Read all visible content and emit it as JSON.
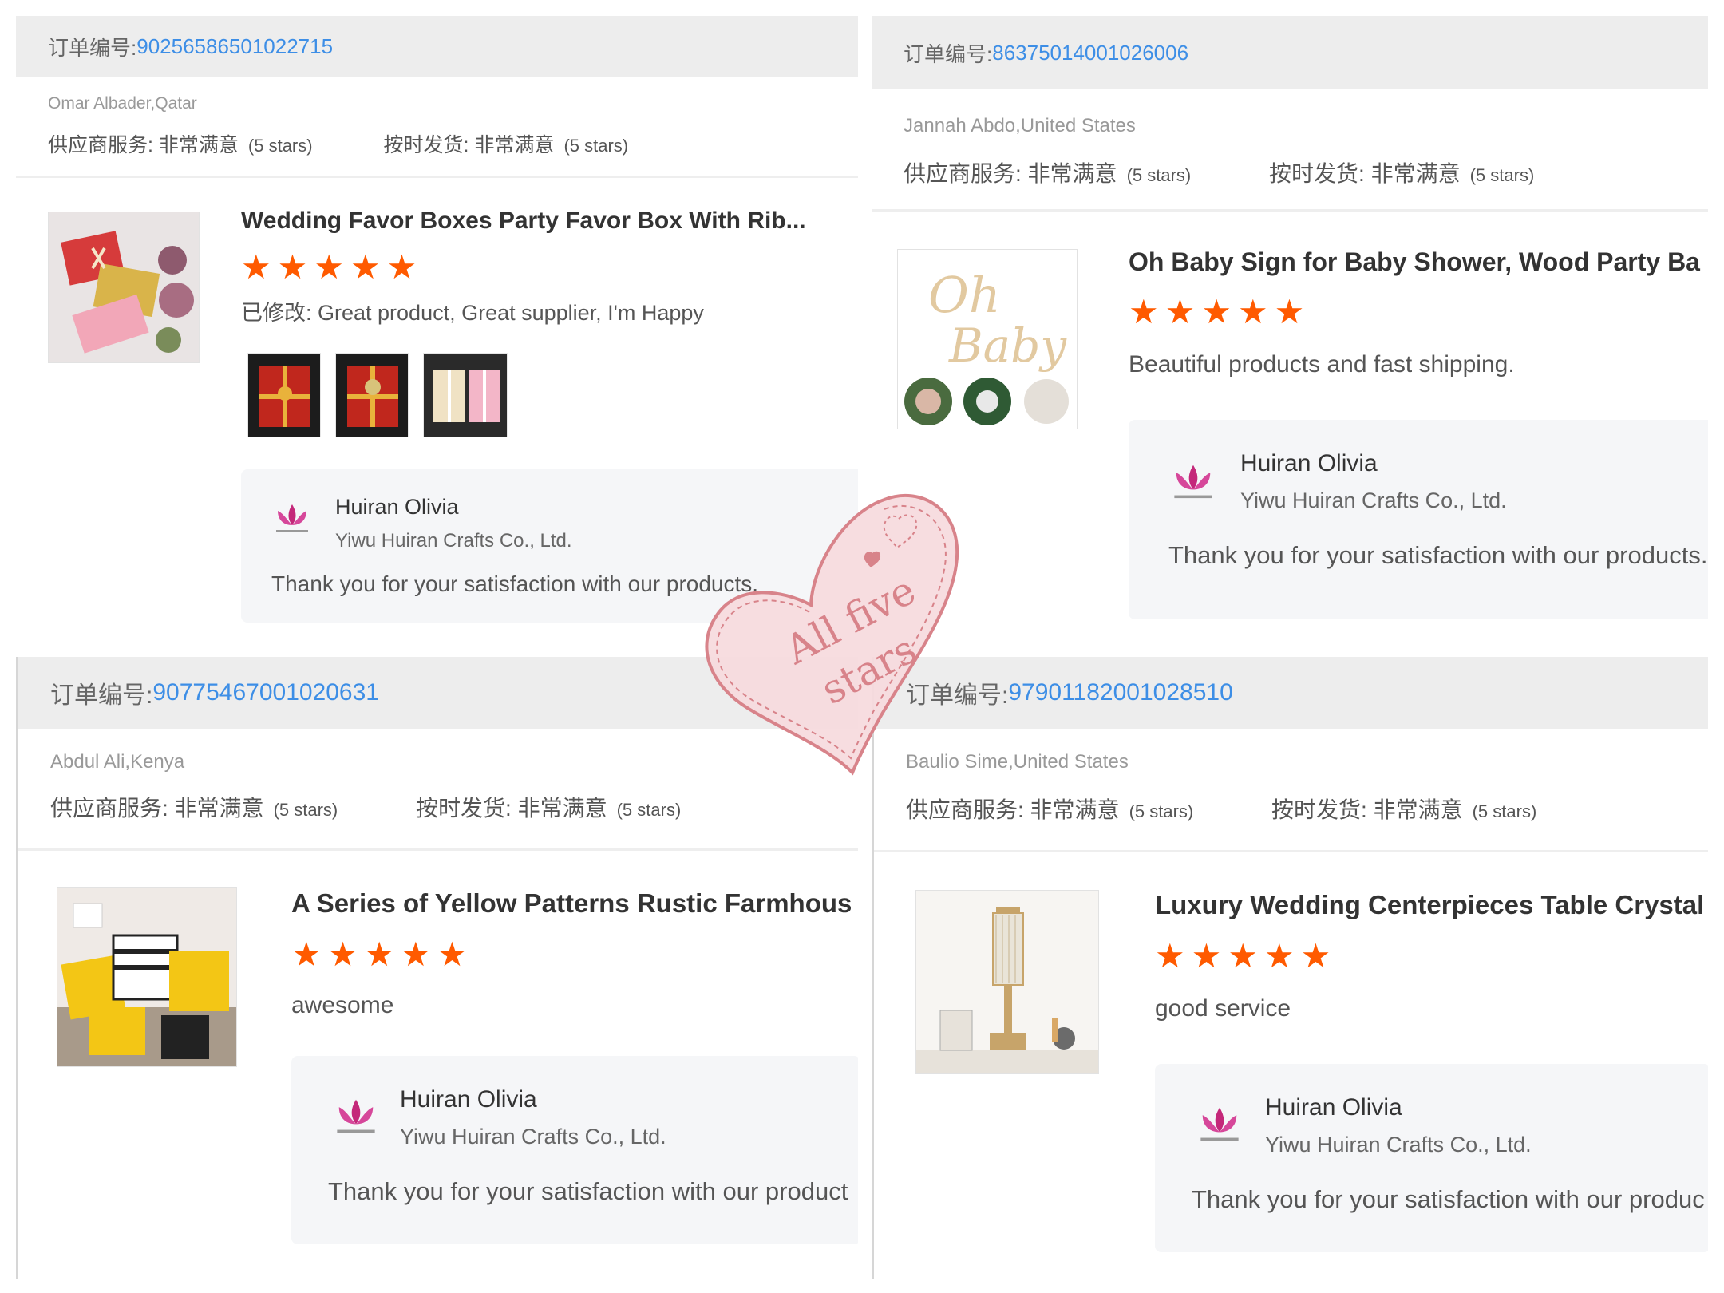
{
  "reviews": [
    {
      "order_label": "订单编号:",
      "order_number": "9025658650102271​5",
      "buyer": "Omar Albader,Qatar",
      "supplier_service_label": "供应商服务: 非常满意",
      "supplier_service_stars": "(5 stars)",
      "shipping_label": "按时发货: 非常满意",
      "shipping_stars": "(5 stars)",
      "product_title": "Wedding Favor Boxes Party Favor Box With Rib...",
      "rating": 5,
      "comment": "已修改: Great product, Great supplier, I'm Happy",
      "photos": [
        "red-gift-box-photo",
        "red-gift-box-photo",
        "pink-gift-box-photo"
      ],
      "reply": {
        "name": "Huiran Olivia",
        "company": "Yiwu Huiran Crafts Co., Ltd.",
        "message": "Thank you for your satisfaction with our products."
      }
    },
    {
      "order_label": "订单编号:",
      "order_number": "86375014001026006",
      "buyer": "Jannah Abdo,United States",
      "supplier_service_label": "供应商服务: 非常满意",
      "supplier_service_stars": "(5 stars)",
      "shipping_label": "按时发货: 非常满意",
      "shipping_stars": "(5 stars)",
      "product_title": "Oh Baby Sign for Baby Shower, Wood Party Ba",
      "rating": 5,
      "comment": "Beautiful products and fast shipping.",
      "reply": {
        "name": "Huiran Olivia",
        "company": "Yiwu Huiran Crafts Co., Ltd.",
        "message": "Thank you for your satisfaction with our products."
      }
    },
    {
      "order_label": "订单编号:",
      "order_number": "90775467001020631",
      "buyer": "Abdul Ali,Kenya",
      "supplier_service_label": "供应商服务: 非常满意",
      "supplier_service_stars": "(5 stars)",
      "shipping_label": "按时发货: 非常满意",
      "shipping_stars": "(5 stars)",
      "product_title": "A Series of Yellow Patterns Rustic Farmhous",
      "rating": 5,
      "comment": "awesome",
      "reply": {
        "name": "Huiran Olivia",
        "company": "Yiwu Huiran Crafts Co., Ltd.",
        "message": "Thank you for your satisfaction with our product"
      }
    },
    {
      "order_label": "订单编号:",
      "order_number": "97901182001028510",
      "buyer": "Baulio Sime,United States",
      "supplier_service_label": "供应商服务: 非常满意",
      "supplier_service_stars": "(5 stars)",
      "shipping_label": "按时发货: 非常满意",
      "shipping_stars": "(5 stars)",
      "product_title": "Luxury Wedding Centerpieces Table Crystal",
      "rating": 5,
      "comment": "good service",
      "reply": {
        "name": "Huiran Olivia",
        "company": "Yiwu Huiran Crafts Co., Ltd.",
        "message": "Thank you for your satisfaction with our produc"
      }
    }
  ],
  "sticker": {
    "line1": "All five",
    "line2": "stars"
  },
  "colors": {
    "order_number": "#3d8ee6",
    "star": "#ff5a00",
    "header_bg": "#ededed",
    "sticker_pink": "#d8838a"
  },
  "icons": {
    "star": "star-icon",
    "seller_logo": "lotus-logo-icon"
  }
}
